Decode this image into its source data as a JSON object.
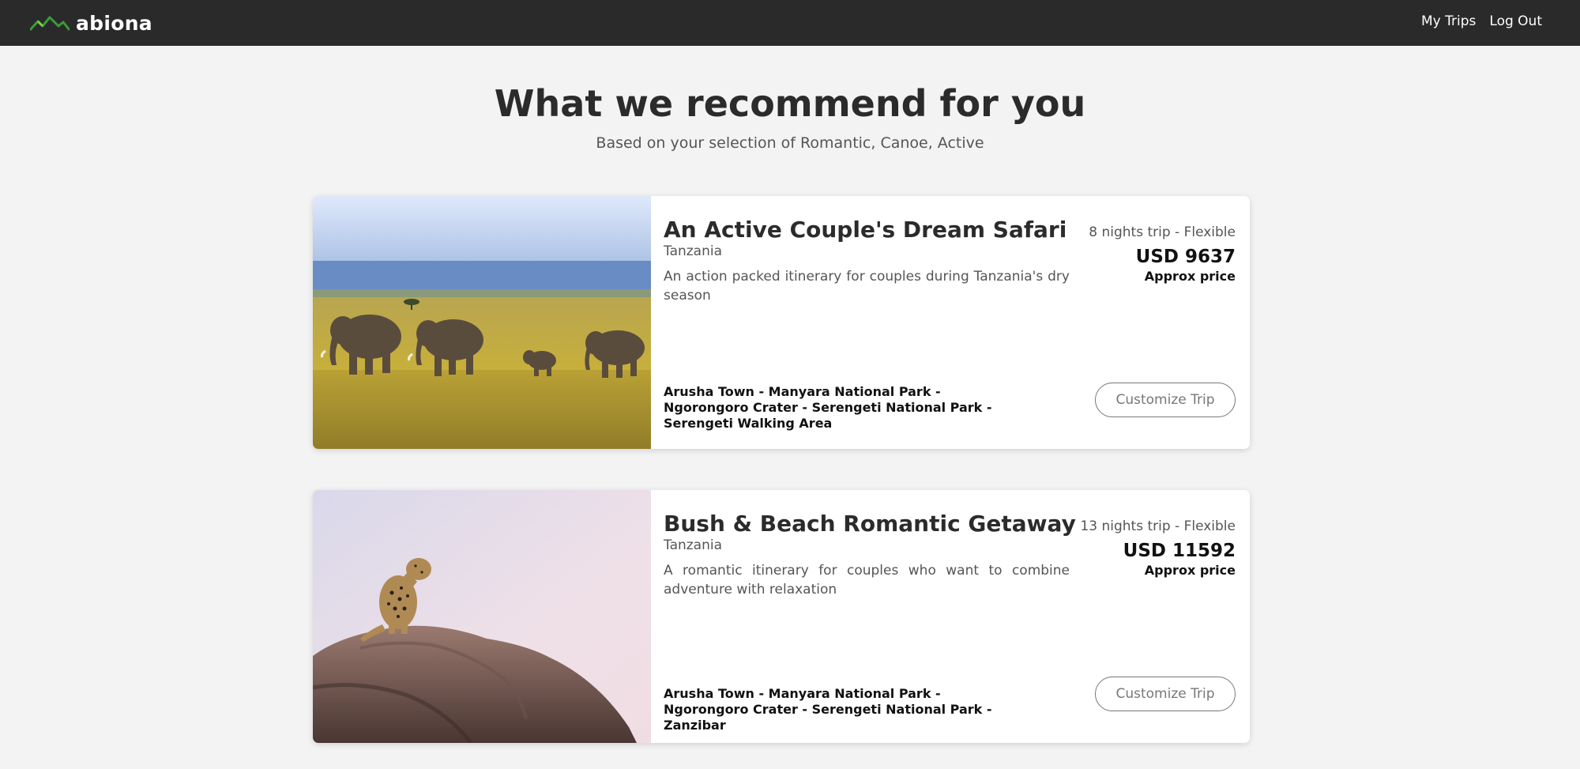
{
  "brand": {
    "name": "abiona",
    "logo_icon": "mountain-logo-icon",
    "accent": "#3a9b3a"
  },
  "nav": {
    "my_trips": "My Trips",
    "log_out": "Log Out"
  },
  "header": {
    "title": "What we recommend for you",
    "subtitle": "Based on your selection of Romantic, Canoe, Active"
  },
  "trips": [
    {
      "title": "An Active Couple's Dream Safari",
      "country": "Tanzania",
      "description": "An action packed itinerary for couples during Tanzania's dry season",
      "nights": "8 nights trip - Flexible",
      "price": "USD 9637",
      "price_note": "Approx price",
      "route": "Arusha Town - Manyara National Park - Ngorongoro Crater - Serengeti National Park - Serengeti Walking Area",
      "button_label": "Customize Trip",
      "image_name": "elephants-photo"
    },
    {
      "title": "Bush & Beach Romantic Getaway",
      "country": "Tanzania",
      "description": "A romantic itinerary for couples who want to combine adventure with relaxation",
      "nights": "13 nights trip - Flexible",
      "price": "USD 11592",
      "price_note": "Approx price",
      "route": "Arusha Town - Manyara National Park - Ngorongoro Crater - Serengeti National Park - Zanzibar",
      "button_label": "Customize Trip",
      "image_name": "leopard-photo"
    }
  ]
}
